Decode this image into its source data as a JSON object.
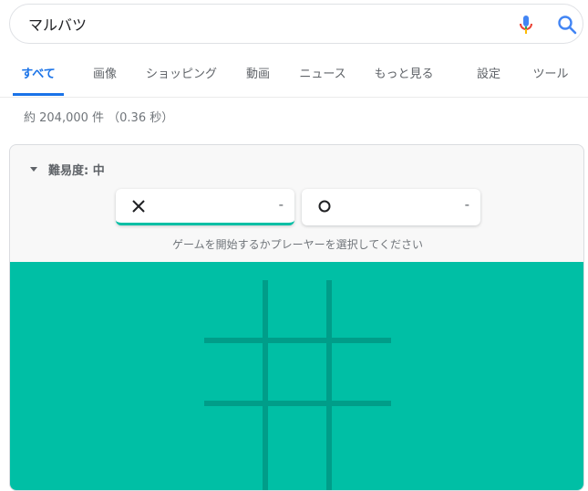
{
  "search": {
    "query": "マルバツ"
  },
  "icons": {
    "mic": "mic-icon",
    "search": "search-icon",
    "triangle": "triangle-down-icon",
    "player_x": "x-mark-icon",
    "player_o": "o-mark-icon"
  },
  "tabs": [
    {
      "label": "すべて",
      "active": true
    },
    {
      "label": "画像",
      "active": false
    },
    {
      "label": "ショッピング",
      "active": false
    },
    {
      "label": "動画",
      "active": false
    },
    {
      "label": "ニュース",
      "active": false
    },
    {
      "label": "もっと見る",
      "active": false
    },
    {
      "label": "設定",
      "active": false
    },
    {
      "label": "ツール",
      "active": false
    }
  ],
  "result_stats": "約 204,000 件 （0.36 秒）",
  "game": {
    "difficulty_label": "難易度: 中",
    "player_x": {
      "symbol": "X",
      "score": "-",
      "selected": true
    },
    "player_o": {
      "symbol": "O",
      "score": "-",
      "selected": false
    },
    "hint": "ゲームを開始するかプレーヤーを選択してください",
    "colors": {
      "board": "#00bfa5",
      "grid": "#009d89",
      "accent": "#1a73e8"
    }
  }
}
